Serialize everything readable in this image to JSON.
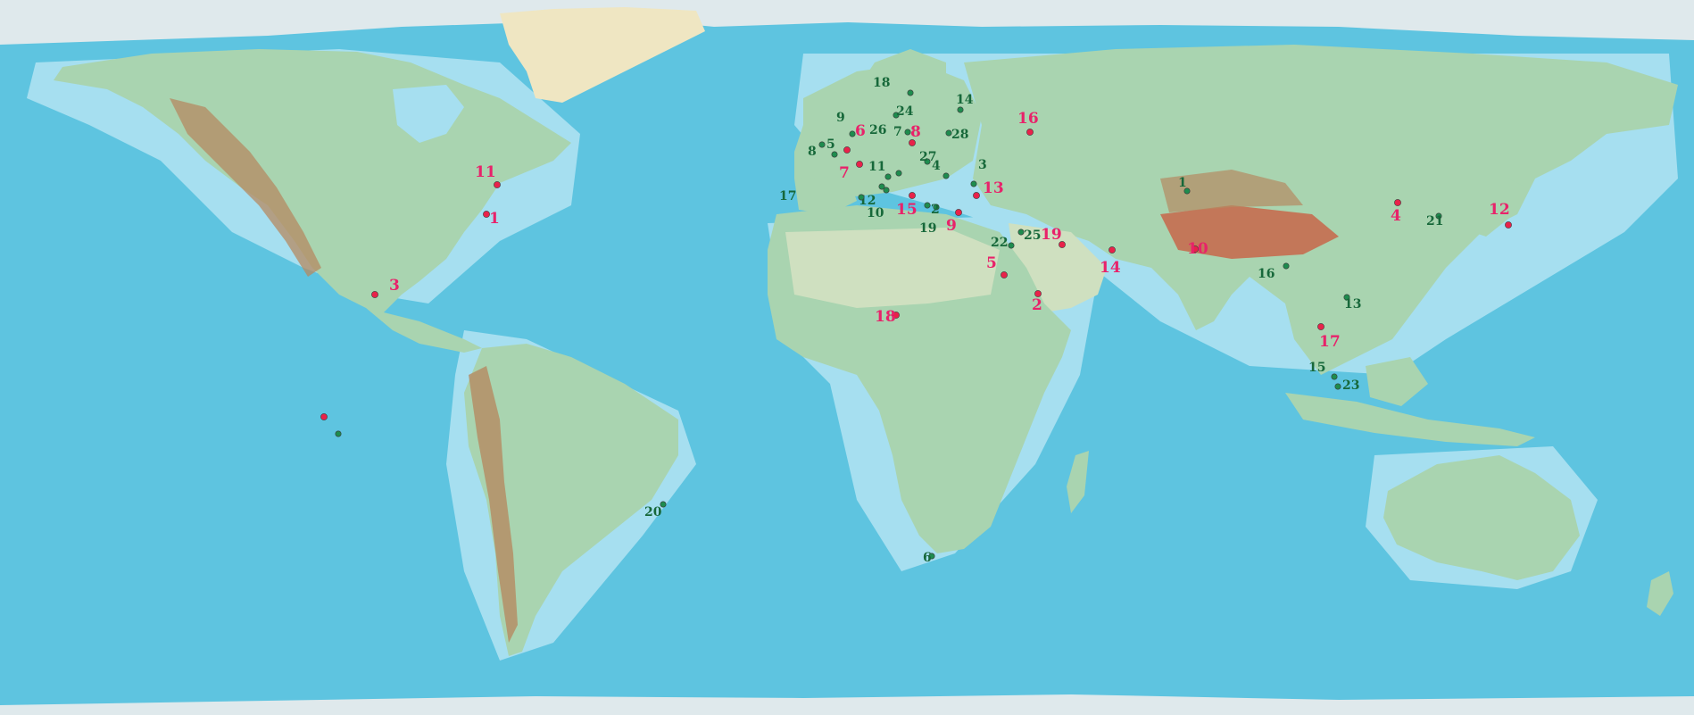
{
  "map": {
    "type": "world physical relief map",
    "colors": {
      "ocean": "#5ec4e0",
      "shelf": "#a6dff0",
      "land": "#a9d4b0",
      "desert": "#cfe0c0",
      "mountain": "#b58a62",
      "highland": "#c8664a",
      "ice": "#efe6c2",
      "arctic": "#dfe9ec",
      "red_marker": "#e8224a",
      "green_marker": "#1e8c4e",
      "red_label": "#e8226a",
      "green_label": "#17683a"
    },
    "red_markers": [
      {
        "label": "1"
      },
      {
        "label": "2"
      },
      {
        "label": "3"
      },
      {
        "label": "4"
      },
      {
        "label": "5"
      },
      {
        "label": "6"
      },
      {
        "label": "7"
      },
      {
        "label": "8"
      },
      {
        "label": "9"
      },
      {
        "label": "10"
      },
      {
        "label": "11"
      },
      {
        "label": "12"
      },
      {
        "label": "13"
      },
      {
        "label": "14"
      },
      {
        "label": "15"
      },
      {
        "label": "16"
      },
      {
        "label": "17"
      },
      {
        "label": "18"
      },
      {
        "label": "19"
      },
      {
        "label": ""
      }
    ],
    "green_markers": [
      {
        "label": "1"
      },
      {
        "label": "2"
      },
      {
        "label": "3"
      },
      {
        "label": "4"
      },
      {
        "label": "5"
      },
      {
        "label": "6"
      },
      {
        "label": "7"
      },
      {
        "label": "8"
      },
      {
        "label": "9"
      },
      {
        "label": "10"
      },
      {
        "label": "11"
      },
      {
        "label": "12"
      },
      {
        "label": "13"
      },
      {
        "label": "14"
      },
      {
        "label": "15"
      },
      {
        "label": "16"
      },
      {
        "label": "17"
      },
      {
        "label": "18"
      },
      {
        "label": "19"
      },
      {
        "label": "20"
      },
      {
        "label": "21"
      },
      {
        "label": "22"
      },
      {
        "label": "23"
      },
      {
        "label": "24"
      },
      {
        "label": "25"
      },
      {
        "label": "26"
      },
      {
        "label": "27"
      },
      {
        "label": "28"
      },
      {
        "label": ""
      }
    ]
  }
}
